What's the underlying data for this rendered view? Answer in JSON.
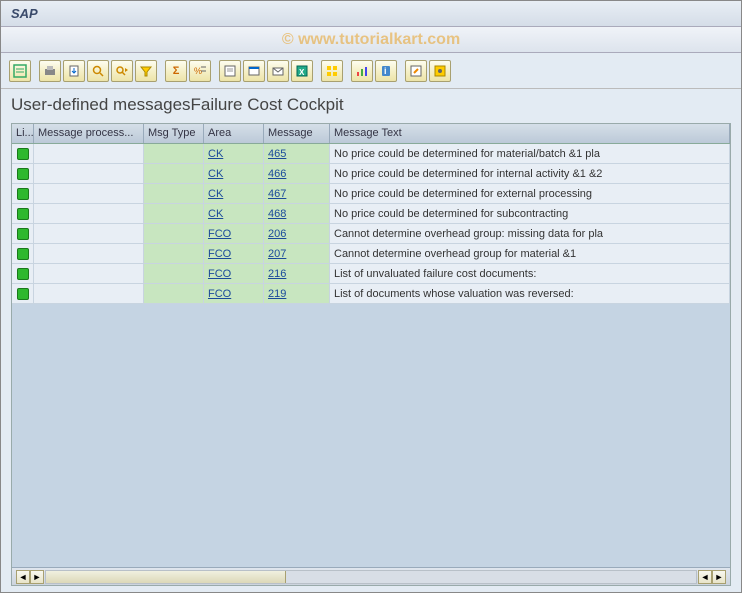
{
  "titlebar": {
    "title": "SAP"
  },
  "watermark": "© www.tutorialkart.com",
  "heading": "User-defined messagesFailure Cost Cockpit",
  "columns": {
    "li": "Li...",
    "proc": "Message process...",
    "type": "Msg Type",
    "area": "Area",
    "msg": "Message",
    "text": "Message Text"
  },
  "rows": [
    {
      "area": "CK",
      "msg": "465",
      "text": "No price could be determined for material/batch &1 pla"
    },
    {
      "area": "CK",
      "msg": "466",
      "text": "No price could be determined for internal activity &1 &2"
    },
    {
      "area": "CK",
      "msg": "467",
      "text": "No price could be determined for external processing"
    },
    {
      "area": "CK",
      "msg": "468",
      "text": "No price could be determined for subcontracting"
    },
    {
      "area": "FCO",
      "msg": "206",
      "text": "Cannot determine overhead group: missing data for pla"
    },
    {
      "area": "FCO",
      "msg": "207",
      "text": "Cannot determine overhead group for material &1"
    },
    {
      "area": "FCO",
      "msg": "216",
      "text": "List of unvaluated failure cost documents:"
    },
    {
      "area": "FCO",
      "msg": "219",
      "text": "List of documents whose valuation was reversed:"
    }
  ]
}
